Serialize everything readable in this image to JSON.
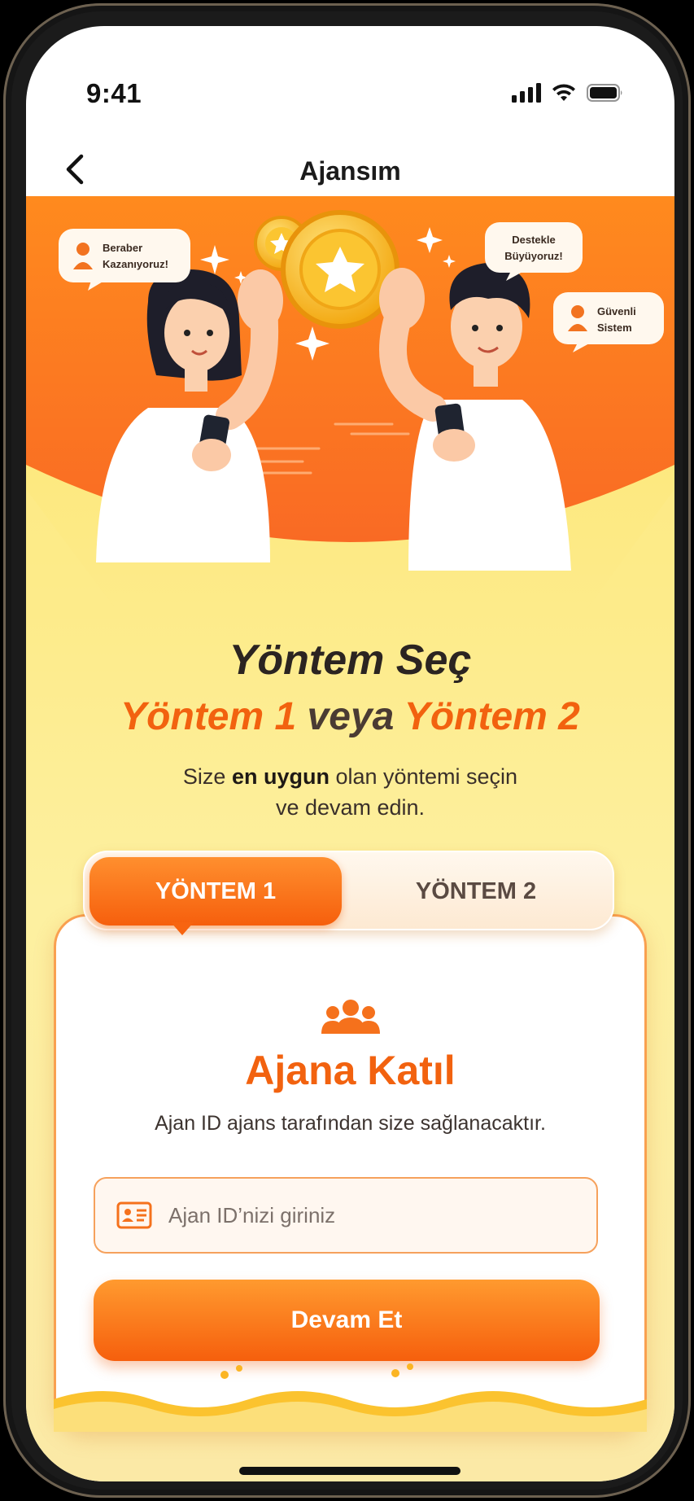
{
  "status_bar": {
    "time": "9:41"
  },
  "nav": {
    "title": "Ajansım"
  },
  "hero": {
    "bubbles": [
      {
        "line1": "Beraber",
        "line2": "Kazanıyoruz!"
      },
      {
        "line1": "Destekle",
        "line2": "Büyüyoruz!"
      },
      {
        "line1": "Güvenli",
        "line2": "Sistem"
      }
    ]
  },
  "heading": {
    "title": "Yöntem Seç",
    "option1": "Yöntem 1",
    "connector": "veya",
    "option2": "Yöntem 2",
    "sub_before": "Size ",
    "sub_bold": "en uygun",
    "sub_after": " olan yöntemi seçin",
    "sub_line2": "ve devam edin."
  },
  "tabs": {
    "tab1": "YÖNTEM 1",
    "tab2": "YÖNTEM 2",
    "active": "tab1"
  },
  "card": {
    "icon": "group-icon",
    "title": "Ajana Katıl",
    "description": "Ajan ID ajans tarafından size sağlanacaktır.",
    "input_placeholder": "Ajan ID’nizi giriniz",
    "input_value": "",
    "button_label": "Devam Et"
  },
  "colors": {
    "accent": "#f65f0d",
    "accent_light": "#ff9a2f",
    "background": "#fde46b"
  }
}
